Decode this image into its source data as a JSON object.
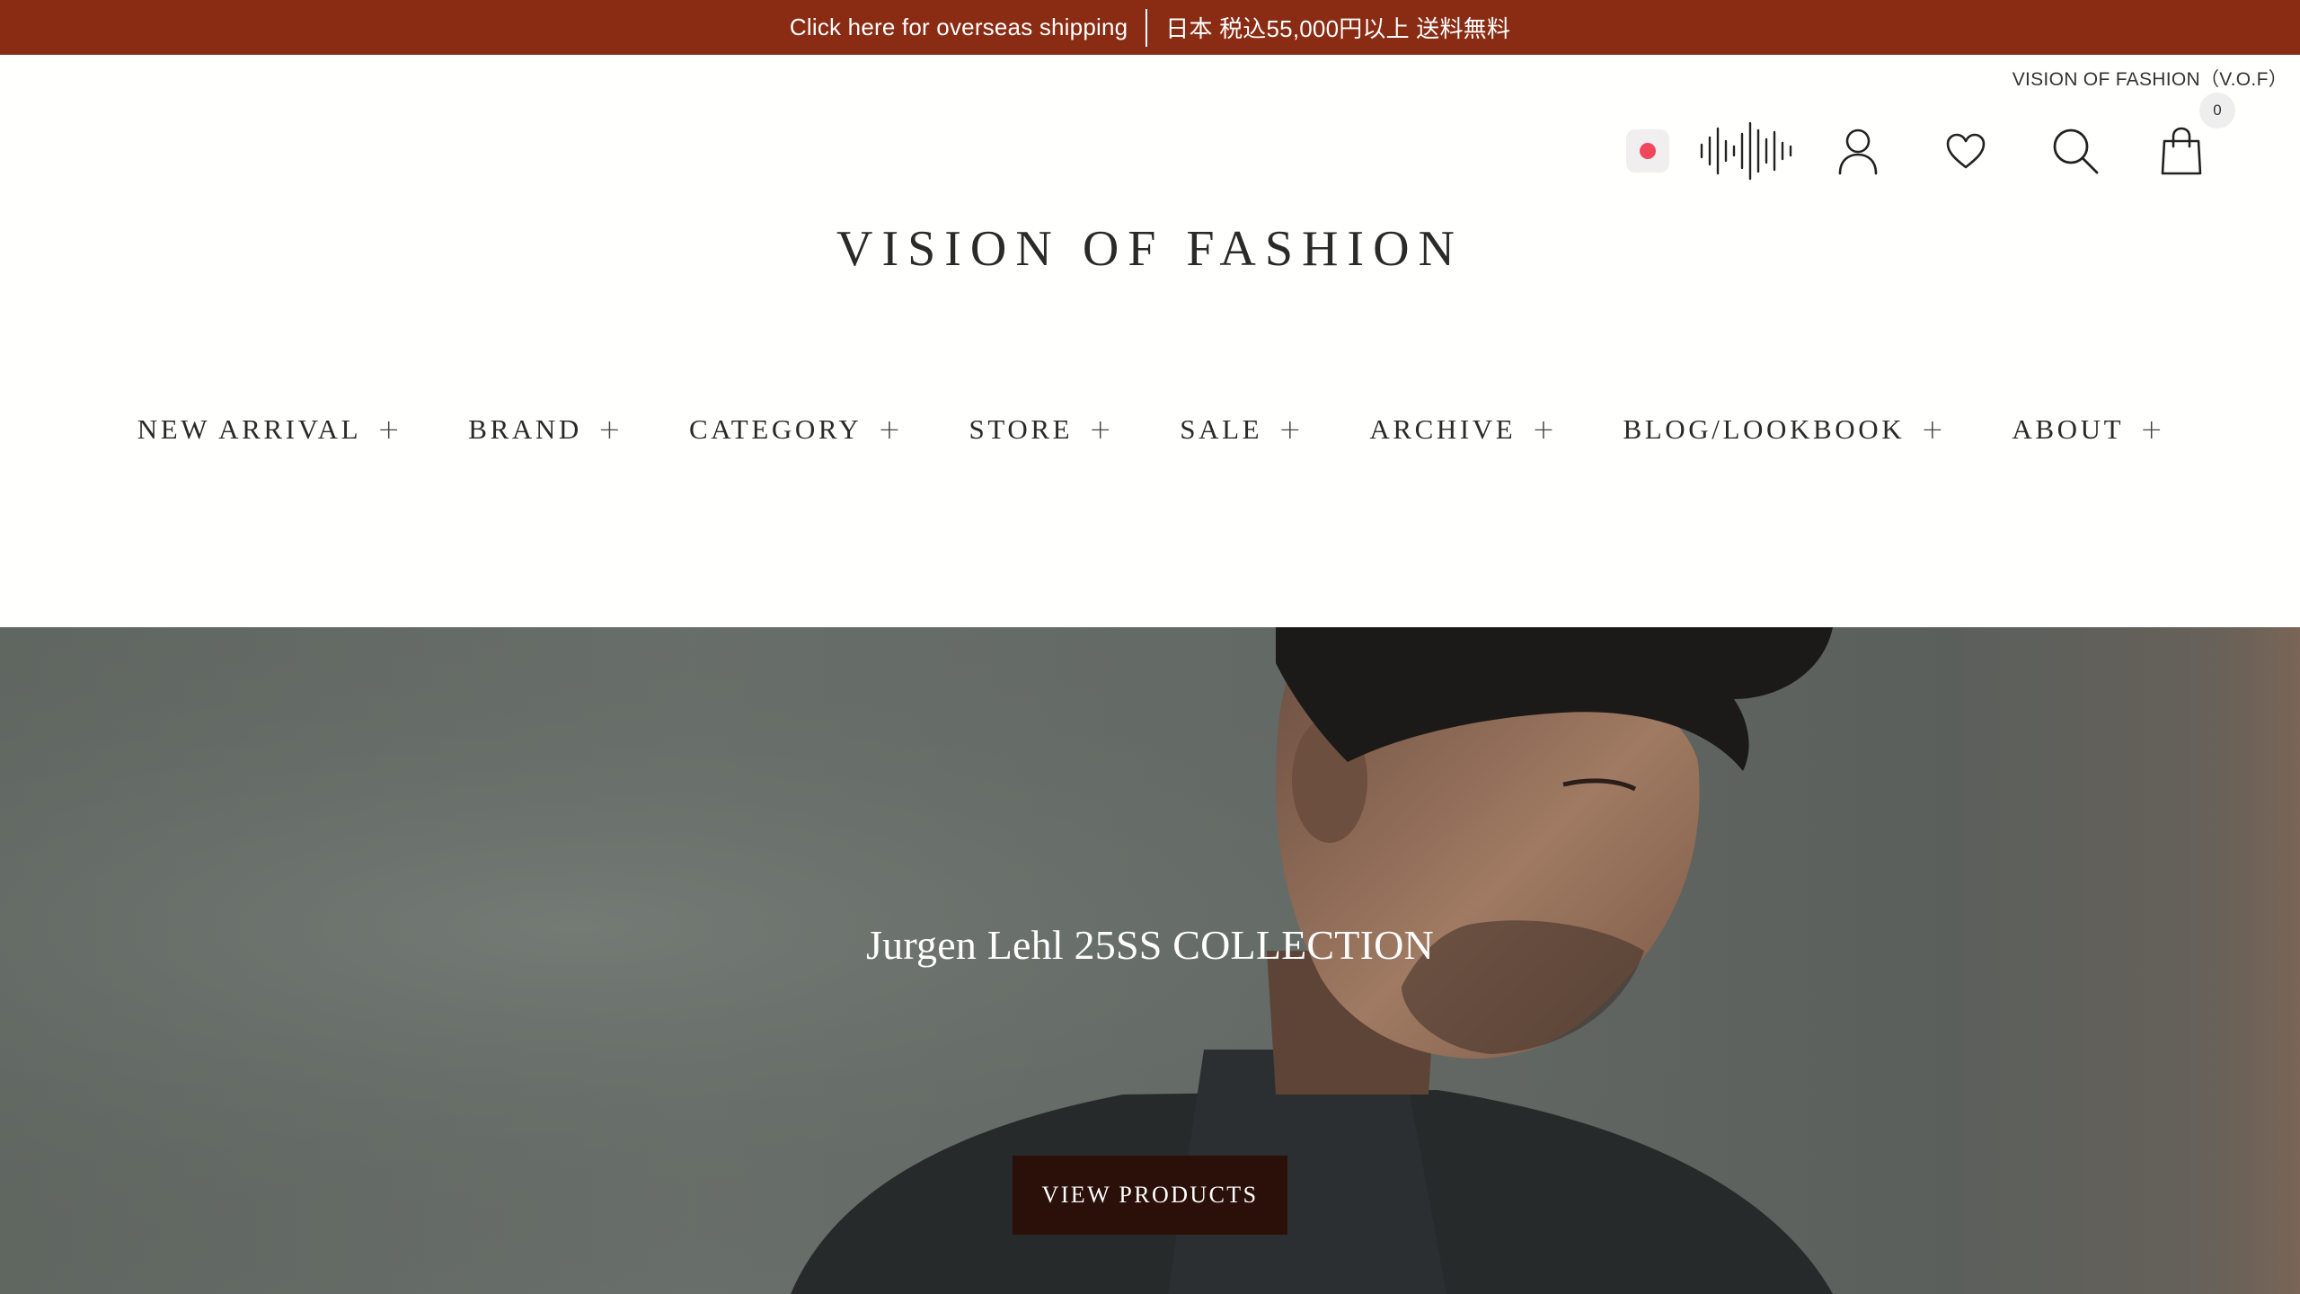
{
  "announcement": {
    "shipping_link": "Click here for overseas shipping",
    "free_shipping": "日本 税込55,000円以上 送料無料"
  },
  "header": {
    "store_tag": "VISION OF FASHION（V.O.F）",
    "logo": "VISION OF FASHION",
    "cart_count": "0",
    "icons": [
      "record-icon",
      "sound-wave-icon",
      "account-icon",
      "heart-icon",
      "search-icon",
      "shopping-bag-icon"
    ]
  },
  "nav": {
    "items": [
      {
        "label": "NEW ARRIVAL",
        "expander": "+"
      },
      {
        "label": "BRAND",
        "expander": "+"
      },
      {
        "label": "CATEGORY",
        "expander": "+"
      },
      {
        "label": "STORE",
        "expander": "+"
      },
      {
        "label": "SALE",
        "expander": "+"
      },
      {
        "label": "ARCHIVE",
        "expander": "+"
      },
      {
        "label": "BLOG/LOOKBOOK",
        "expander": "+"
      },
      {
        "label": "ABOUT",
        "expander": "+"
      }
    ]
  },
  "hero": {
    "title": "Jurgen Lehl 25SS COLLECTION",
    "button": "VIEW PRODUCTS"
  },
  "colors": {
    "announcement_bg": "#8a2b13",
    "hero_button_bg": "#2b100a",
    "record_dot": "#f0475c"
  }
}
